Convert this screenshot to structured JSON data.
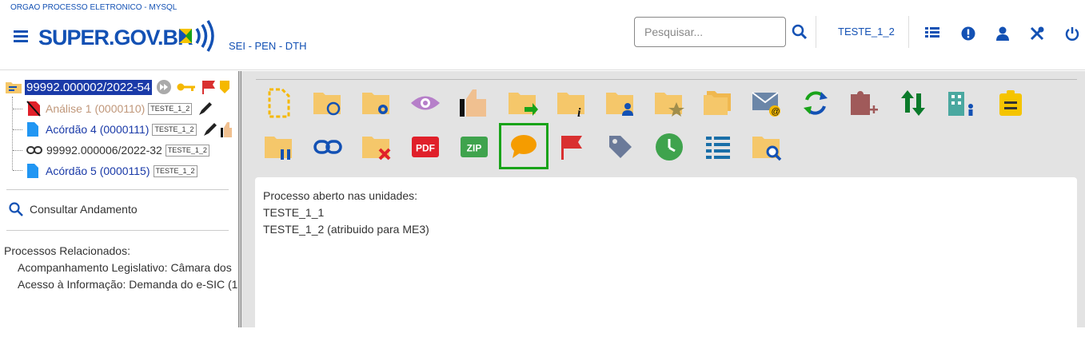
{
  "header": {
    "org": "ORGAO PROCESSO ELETRONICO - MYSQL",
    "logo_text": "SUPER.GOV.BR",
    "subsystem": "SEI - PEN - DTH",
    "search_placeholder": "Pesquisar...",
    "unit": "TESTE_1_2",
    "icons": [
      "search-icon",
      "menu-grid-icon",
      "alert-icon",
      "user-icon",
      "tools-icon",
      "power-icon"
    ]
  },
  "tree": {
    "process": "99992.000002/2022-54",
    "docs": [
      {
        "label": "Análise 1 (0000110)",
        "tag": "TESTE_1_2",
        "color": "#c0977a"
      },
      {
        "label": "Acórdão 4 (0000111)",
        "tag": "TESTE_1_2",
        "color": "#1a3aa8"
      },
      {
        "label": "99992.000006/2022-32",
        "tag": "TESTE_1_2",
        "color": "#333333"
      },
      {
        "label": "Acórdão 5 (0000115)",
        "tag": "TESTE_1_2",
        "color": "#1a3aa8"
      }
    ]
  },
  "consult": "Consultar Andamento",
  "related": {
    "title": "Processos Relacionados:",
    "items": [
      "Acompanhamento Legislativo: Câmara dos",
      "Acesso à Informação: Demanda do e-SIC (1"
    ]
  },
  "toolbar": {
    "row1": [
      "new-document-icon",
      "folder-sync-icon",
      "folder-settings-icon",
      "eye-icon",
      "thumb-up-icon",
      "folder-send-icon",
      "folder-info-icon",
      "folder-user-icon",
      "folder-star-icon",
      "folders-icon",
      "email-icon",
      "refresh-icon",
      "puzzle-add-icon",
      "arrows-updown-icon",
      "building-user-icon",
      "note-icon"
    ],
    "row2": [
      "folder-pause-icon",
      "link-icon",
      "folder-delete-icon",
      "pdf-icon",
      "zip-icon",
      "comment-icon",
      "flag-icon",
      "tag-icon",
      "clock-icon",
      "list-icon",
      "folder-search-icon"
    ],
    "pdf_label": "PDF",
    "zip_label": "ZIP"
  },
  "content": {
    "lines": [
      "Processo aberto nas unidades:",
      "TESTE_1_1",
      "TESTE_1_2 (atribuido para ME3)"
    ]
  },
  "colors": {
    "brand": "#1351b4",
    "folder": "#f5c76a",
    "selected": "#19a319"
  }
}
